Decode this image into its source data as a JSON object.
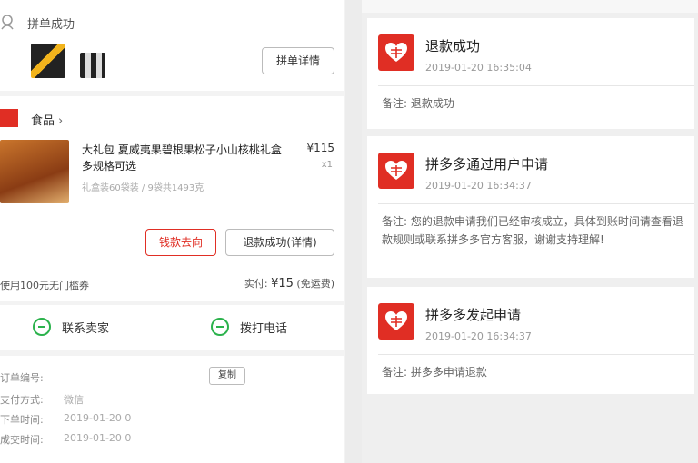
{
  "left": {
    "group": {
      "title": "拼单成功",
      "detail_button": "拼单详情"
    },
    "order": {
      "shop_name": "食品",
      "product_title": "大礼包 夏威夷果碧根果松子小山核桃礼盒 多规格可选",
      "product_price": "¥115",
      "product_qty": "x1",
      "product_spec": "礼盒装60袋装 / 9袋共1493克",
      "refund_direction_button": "钱款去向",
      "refund_detail_button": "退款成功(详情)",
      "service_note": "使用100元无门槛券",
      "paid_label": "实付:",
      "paid_amount": "¥15",
      "shipping_note": "(免运费)"
    },
    "contact": {
      "seller_label": "联系卖家",
      "phone_label": "拨打电话"
    },
    "info": {
      "order_no_label": "订单编号:",
      "copy_button": "复制",
      "pay_method_label": "支付方式:",
      "pay_method_value": "微信",
      "order_time_label": "下单时间:",
      "order_time_value": "2019-01-20 0",
      "deal_time_label": "成交时间:",
      "deal_time_value": "2019-01-20 0"
    }
  },
  "right": {
    "steps": [
      {
        "title": "退款成功",
        "time": "2019-01-20 16:35:04",
        "note": "备注: 退款成功"
      },
      {
        "title": "拼多多通过用户申请",
        "time": "2019-01-20 16:34:37",
        "note": "备注: 您的退款申请我们已经审核成立，具体到账时间请查看退款规则或联系拼多多官方客服，谢谢支持理解!"
      },
      {
        "title": "拼多多发起申请",
        "time": "2019-01-20 16:34:37",
        "note": "备注: 拼多多申请退款"
      }
    ]
  },
  "colors": {
    "brand_red": "#e02e24",
    "wechat_green": "#2bb24c"
  }
}
